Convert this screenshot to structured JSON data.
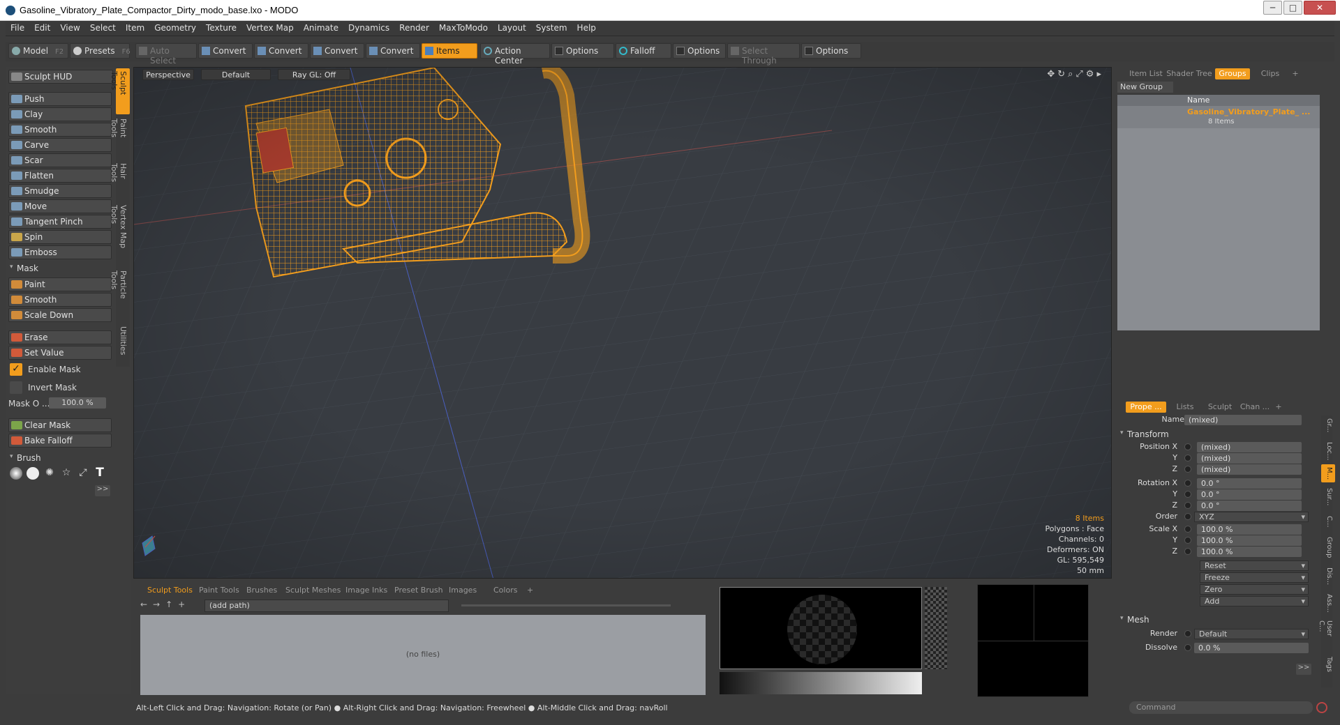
{
  "window": {
    "title": "Gasoline_Vibratory_Plate_Compactor_Dirty_modo_base.lxo - MODO",
    "minimize": "─",
    "maximize": "□",
    "close": "✕"
  },
  "menu": [
    "File",
    "Edit",
    "View",
    "Select",
    "Item",
    "Geometry",
    "Texture",
    "Vertex Map",
    "Animate",
    "Dynamics",
    "Render",
    "MaxToModo",
    "Layout",
    "System",
    "Help"
  ],
  "toolbar": {
    "model": "Model",
    "model_key": "F2",
    "presets": "Presets",
    "presets_key": "F6",
    "auto_select": "Auto Select",
    "convert": "Convert",
    "items": "Items",
    "action_center": "Action Center",
    "options": "Options",
    "falloff": "Falloff",
    "select_through": "Select Through"
  },
  "sculpt": {
    "hud": "Sculpt HUD",
    "tools": [
      "Push",
      "Clay",
      "Smooth",
      "Carve",
      "Scar",
      "Flatten",
      "Smudge",
      "Move",
      "Tangent Pinch",
      "Spin",
      "Emboss"
    ],
    "mask_header": "Mask",
    "mask_tools": [
      "Paint",
      "Smooth",
      "Scale Down"
    ],
    "erase": "Erase",
    "set_value": "Set Value",
    "enable_mask": "Enable Mask",
    "invert_mask": "Invert Mask",
    "mask_opacity_label": "Mask O ...",
    "mask_opacity_value": "100.0 %",
    "clear_mask": "Clear Mask",
    "bake_falloff": "Bake Falloff",
    "brush_header": "Brush",
    "expand": ">>"
  },
  "vtabs": [
    "Sculpt Tools",
    "Paint Tools",
    "Hair Tools",
    "Vertex Map Tools",
    "Particle Tools",
    "Utilities"
  ],
  "viewport": {
    "view": "Perspective",
    "style": "Default",
    "raygl": "Ray GL: Off",
    "info": {
      "items": "8 Items",
      "polygons": "Polygons : Face",
      "channels": "Channels: 0",
      "deformers": "Deformers: ON",
      "gl": "GL: 595,549",
      "size": "50 mm"
    },
    "colors": {
      "wire": "#f29d1d",
      "bg": "#383c42"
    }
  },
  "bottom": {
    "tabs": [
      "Sculpt Tools",
      "Paint Tools",
      "Brushes",
      "Sculpt Meshes",
      "Image Inks",
      "Preset Brush",
      "Images",
      "Colors",
      "+"
    ],
    "path": "(add path)",
    "empty": "(no files)"
  },
  "right": {
    "tabs": [
      "Item List",
      "Shader Tree",
      "Groups",
      "Clips",
      "+"
    ],
    "new_group": "New Group",
    "col_name": "Name",
    "group_name": "Gasoline_Vibratory_Plate_ ...",
    "group_count": "8 Items"
  },
  "props": {
    "tabs": [
      "Prope ...",
      "Lists",
      "Sculpt",
      "Chan ...",
      "+"
    ],
    "name_label": "Name",
    "name_value": "(mixed)",
    "transform": "Transform",
    "position_x": "Position X",
    "y": "Y",
    "z": "Z",
    "pos": [
      "(mixed)",
      "(mixed)",
      "(mixed)"
    ],
    "rotation_x": "Rotation X",
    "rot": [
      "0.0 °",
      "0.0 °",
      "0.0 °"
    ],
    "order_label": "Order",
    "order": "XYZ",
    "scale_x": "Scale X",
    "scale": [
      "100.0 %",
      "100.0 %",
      "100.0 %"
    ],
    "buttons": [
      "Reset",
      "Freeze",
      "Zero",
      "Add"
    ],
    "mesh": "Mesh",
    "render_label": "Render",
    "render": "Default",
    "dissolve_label": "Dissolve",
    "dissolve": "0.0 %",
    "expand": ">>",
    "side_tabs": [
      "Gr...",
      "Loc...",
      "M...",
      "Sur...",
      "C...",
      "Group",
      "Dis...",
      "Ass...",
      "User C...",
      "Tags"
    ]
  },
  "status": {
    "text": "Alt-Left Click and Drag: Navigation: Rotate (or Pan) ● Alt-Right Click and Drag: Navigation: Freewheel ● Alt-Middle Click and Drag: navRoll",
    "command": "Command"
  }
}
